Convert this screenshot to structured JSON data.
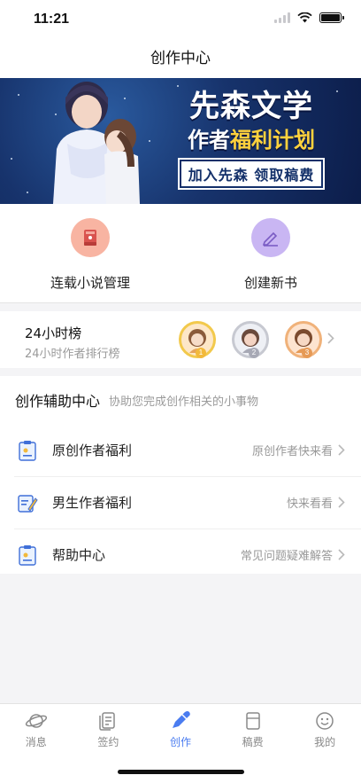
{
  "status": {
    "time": "11:21"
  },
  "nav": {
    "title": "创作中心"
  },
  "banner": {
    "title": "先森文学",
    "subtitle_pre": "作者",
    "subtitle_highlight": "福利计划",
    "pill": "加入先森 领取稿费"
  },
  "actions": [
    {
      "label": "连载小说管理",
      "icon": "book-icon",
      "color": "#f8b4a2"
    },
    {
      "label": "创建新书",
      "icon": "pen-icon",
      "color": "#c9b6f3"
    }
  ],
  "ranking": {
    "title": "24小时榜",
    "subtitle": "24小时作者排行榜",
    "badges": [
      "1",
      "2",
      "3"
    ]
  },
  "assist": {
    "title": "创作辅助中心",
    "desc": "协助您完成创作相关的小事物",
    "items": [
      {
        "label": "原创作者福利",
        "hint": "原创作者快来看",
        "icon": "clipboard-icon"
      },
      {
        "label": "男生作者福利",
        "hint": "快来看看",
        "icon": "edit-note-icon"
      },
      {
        "label": "帮助中心",
        "hint": "常见问题疑难解答",
        "icon": "help-clipboard-icon"
      }
    ]
  },
  "tabs": [
    {
      "label": "消息",
      "icon": "planet-icon"
    },
    {
      "label": "签约",
      "icon": "contract-icon"
    },
    {
      "label": "创作",
      "icon": "pencil-icon",
      "active": true
    },
    {
      "label": "稿费",
      "icon": "wallet-icon"
    },
    {
      "label": "我的",
      "icon": "smile-icon"
    }
  ],
  "colors": {
    "accent": "#4a7cf0",
    "gold": "#f2b93b",
    "silver": "#a7a9b5",
    "bronze": "#e69a56"
  }
}
